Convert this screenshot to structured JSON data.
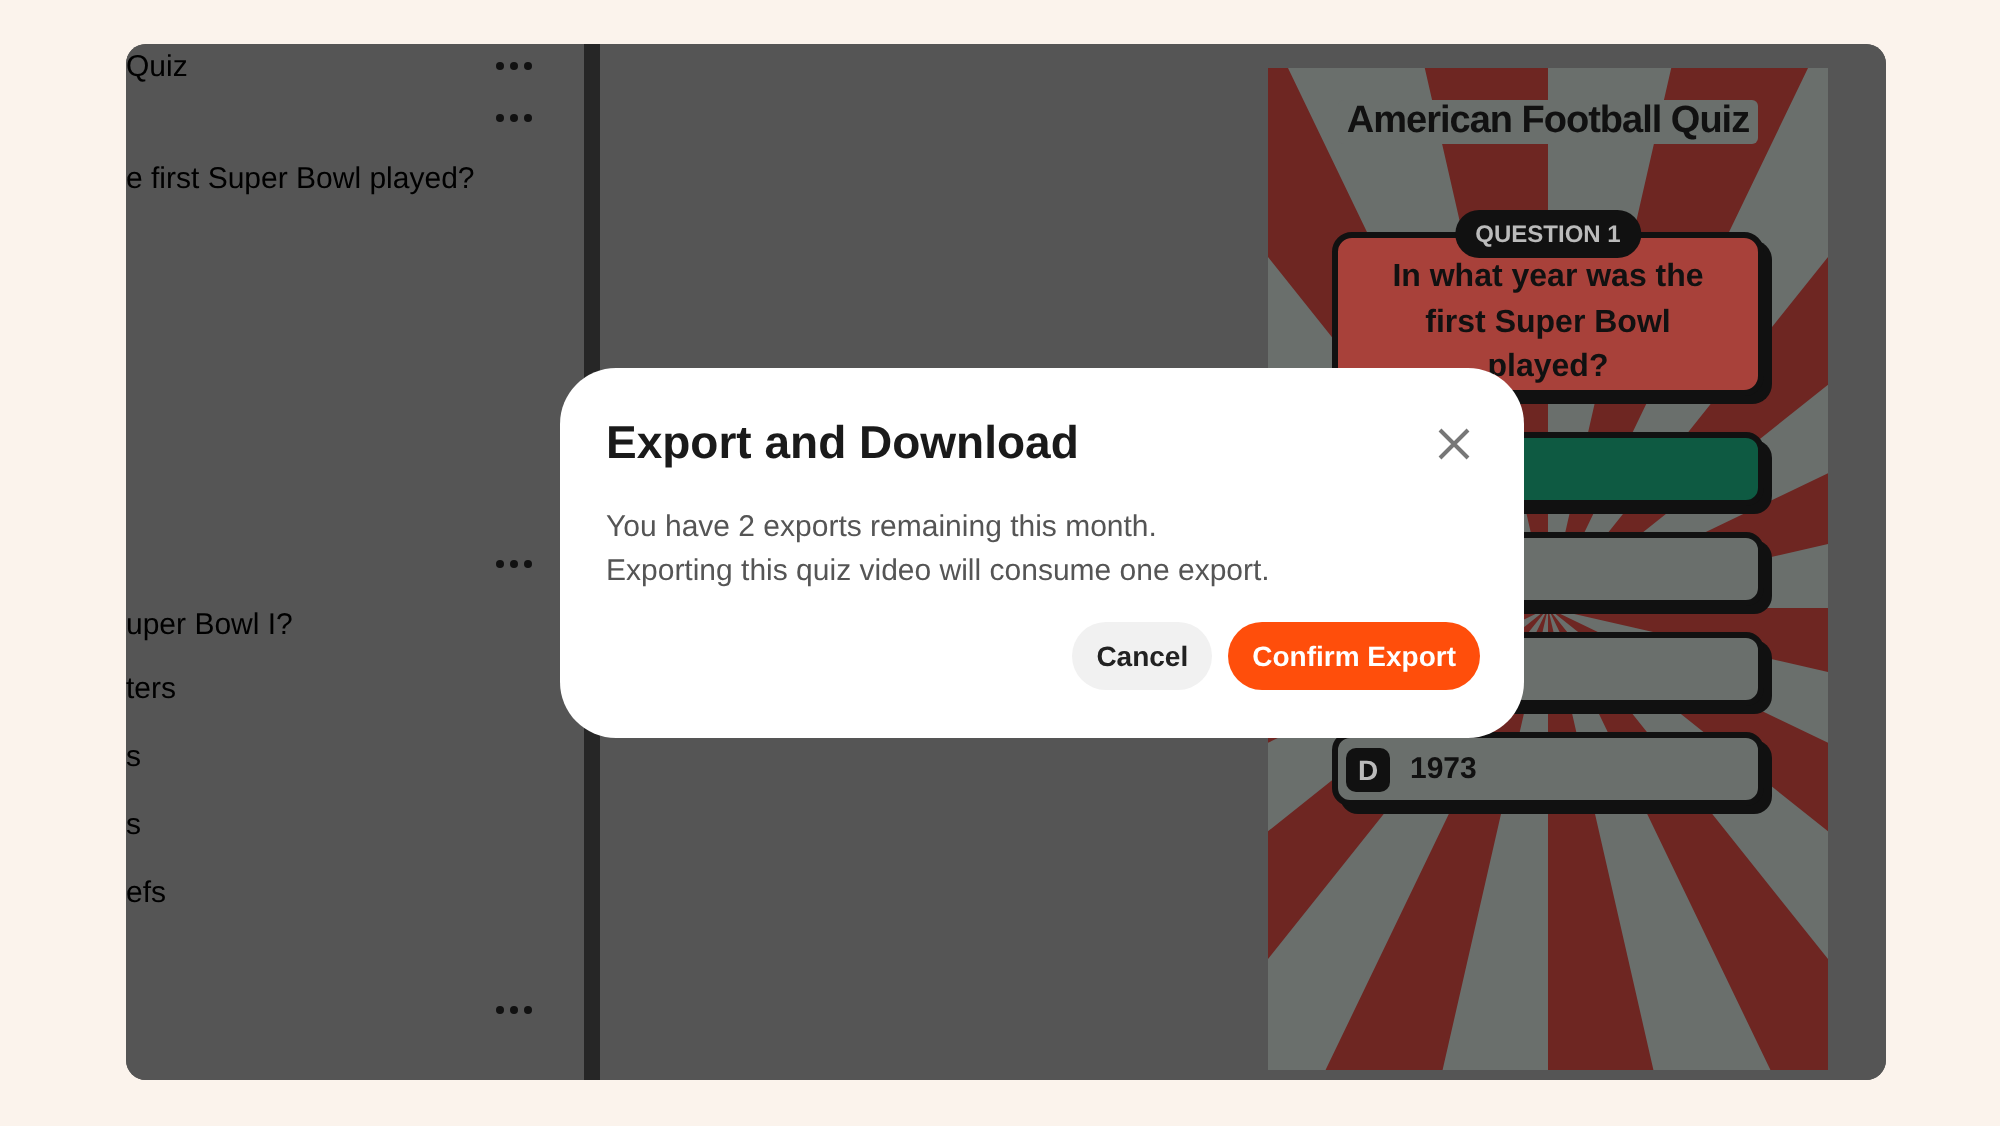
{
  "sidebar": {
    "header": {
      "title": "Quiz"
    },
    "sections": [
      {
        "question": "e first Super Bowl played?"
      },
      {
        "question": "uper Bowl I?",
        "options": [
          "ters",
          "s",
          "s",
          "efs"
        ]
      }
    ]
  },
  "preview": {
    "title": "American Football Quiz",
    "badge": "QUESTION 1",
    "question": "In what year was the first Super Bowl played?",
    "answers": [
      {
        "highlighted": true
      },
      {
        "highlighted": false
      },
      {
        "highlighted": false
      },
      {
        "letter": "D",
        "text": "1973",
        "highlighted": false
      }
    ]
  },
  "dialog": {
    "title": "Export and Download",
    "lines": [
      "You have 2 exports remaining this month.",
      "Exporting this quiz video will consume one export."
    ],
    "buttons": [
      {
        "label": "Cancel",
        "kind": "secondary"
      },
      {
        "label": "Confirm Export",
        "kind": "primary"
      }
    ]
  }
}
